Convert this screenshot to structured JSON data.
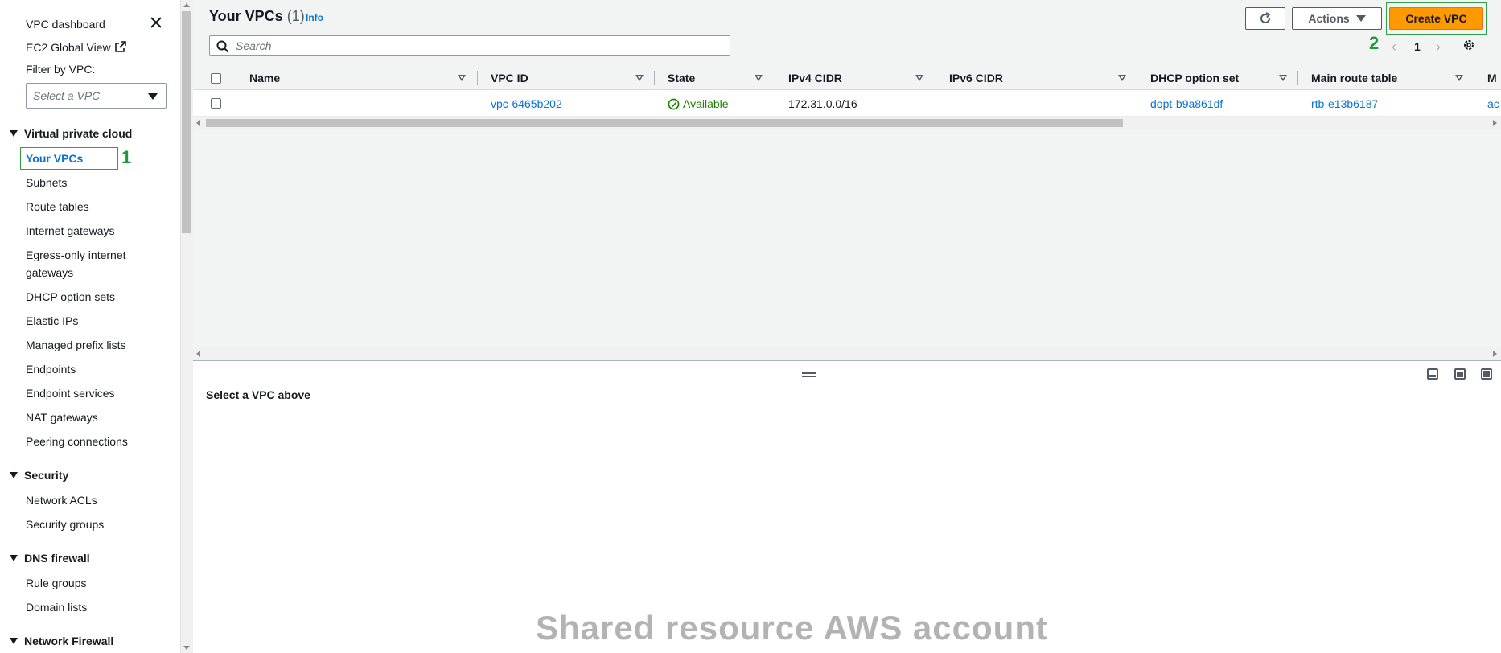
{
  "sidebar": {
    "dashboard": "VPC dashboard",
    "global_view": "EC2 Global View",
    "filter_label": "Filter by VPC:",
    "filter_placeholder": "Select a VPC",
    "sections": [
      {
        "title": "Virtual private cloud",
        "items": [
          "Your VPCs",
          "Subnets",
          "Route tables",
          "Internet gateways",
          "Egress-only internet gateways",
          "DHCP option sets",
          "Elastic IPs",
          "Managed prefix lists",
          "Endpoints",
          "Endpoint services",
          "NAT gateways",
          "Peering connections"
        ]
      },
      {
        "title": "Security",
        "items": [
          "Network ACLs",
          "Security groups"
        ]
      },
      {
        "title": "DNS firewall",
        "items": [
          "Rule groups",
          "Domain lists"
        ]
      },
      {
        "title": "Network Firewall",
        "items": []
      }
    ],
    "active_item": "Your VPCs",
    "egress_line1": "Egress-only internet",
    "egress_line2": "gateways"
  },
  "annotations": {
    "step1": "1",
    "step2": "2"
  },
  "header": {
    "title": "Your VPCs",
    "count": "(1)",
    "info": "Info",
    "search_placeholder": "Search",
    "actions_label": "Actions",
    "create_label": "Create VPC",
    "page_number": "1"
  },
  "table": {
    "columns": [
      "Name",
      "VPC ID",
      "State",
      "IPv4 CIDR",
      "IPv6 CIDR",
      "DHCP option set",
      "Main route table",
      "M"
    ],
    "rows": [
      {
        "name": "–",
        "vpc_id": "vpc-6465b202",
        "state": "Available",
        "ipv4": "172.31.0.0/16",
        "ipv6": "–",
        "dhcp": "dopt-b9a861df",
        "route_table": "rtb-e13b6187",
        "more": "ac"
      }
    ]
  },
  "split_panel": {
    "message": "Select a VPC above"
  },
  "watermark": "Shared resource AWS account",
  "colors": {
    "accent": "#0972d3",
    "primary_button": "#ff9900",
    "status_ok": "#1d8102",
    "highlight": "#2ea043"
  }
}
